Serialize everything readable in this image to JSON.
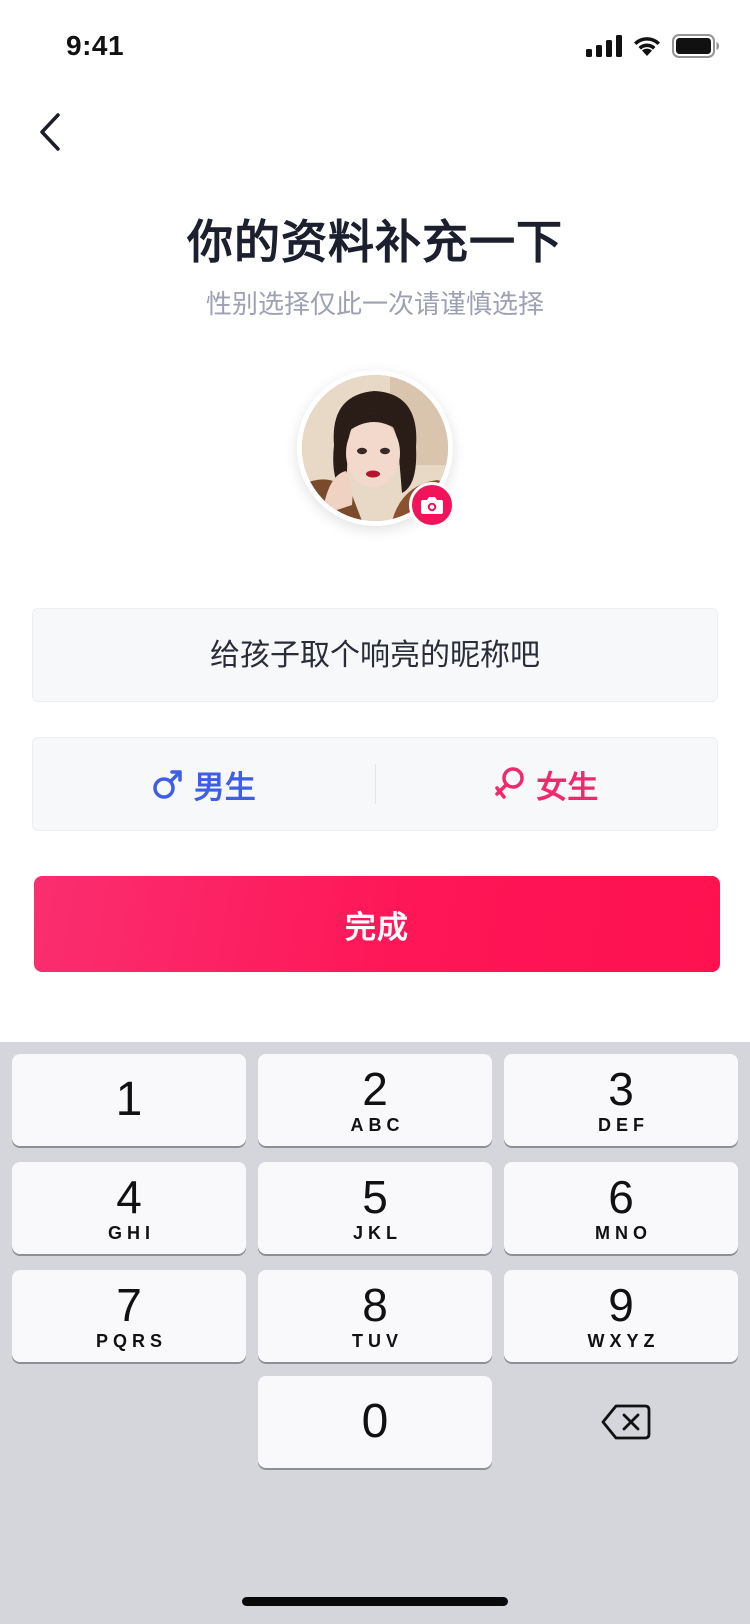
{
  "status_bar": {
    "time": "9:41"
  },
  "header": {
    "title": "你的资料补充一下",
    "subtitle": "性别选择仅此一次请谨慎选择"
  },
  "form": {
    "nickname_placeholder": "给孩子取个响亮的昵称吧",
    "nickname_value": "",
    "gender_options": [
      {
        "label": "男生",
        "icon": "male-symbol-icon",
        "color": "#3e5ee6"
      },
      {
        "label": "女生",
        "icon": "female-symbol-icon",
        "color": "#f1286a"
      }
    ],
    "submit_label": "完成"
  },
  "keyboard": {
    "keys": [
      {
        "num": "1",
        "letters": ""
      },
      {
        "num": "2",
        "letters": "ABC"
      },
      {
        "num": "3",
        "letters": "DEF"
      },
      {
        "num": "4",
        "letters": "GHI"
      },
      {
        "num": "5",
        "letters": "JKL"
      },
      {
        "num": "6",
        "letters": "MNO"
      },
      {
        "num": "7",
        "letters": "PQRS"
      },
      {
        "num": "8",
        "letters": "TUV"
      },
      {
        "num": "9",
        "letters": "WXYZ"
      },
      {
        "num": "0",
        "letters": ""
      }
    ],
    "delete_icon": "backspace-icon"
  },
  "colors": {
    "accent": "#fe1656",
    "male": "#3e5ee6",
    "female": "#f1286a",
    "keyboard_bg": "#d4d6dc"
  }
}
